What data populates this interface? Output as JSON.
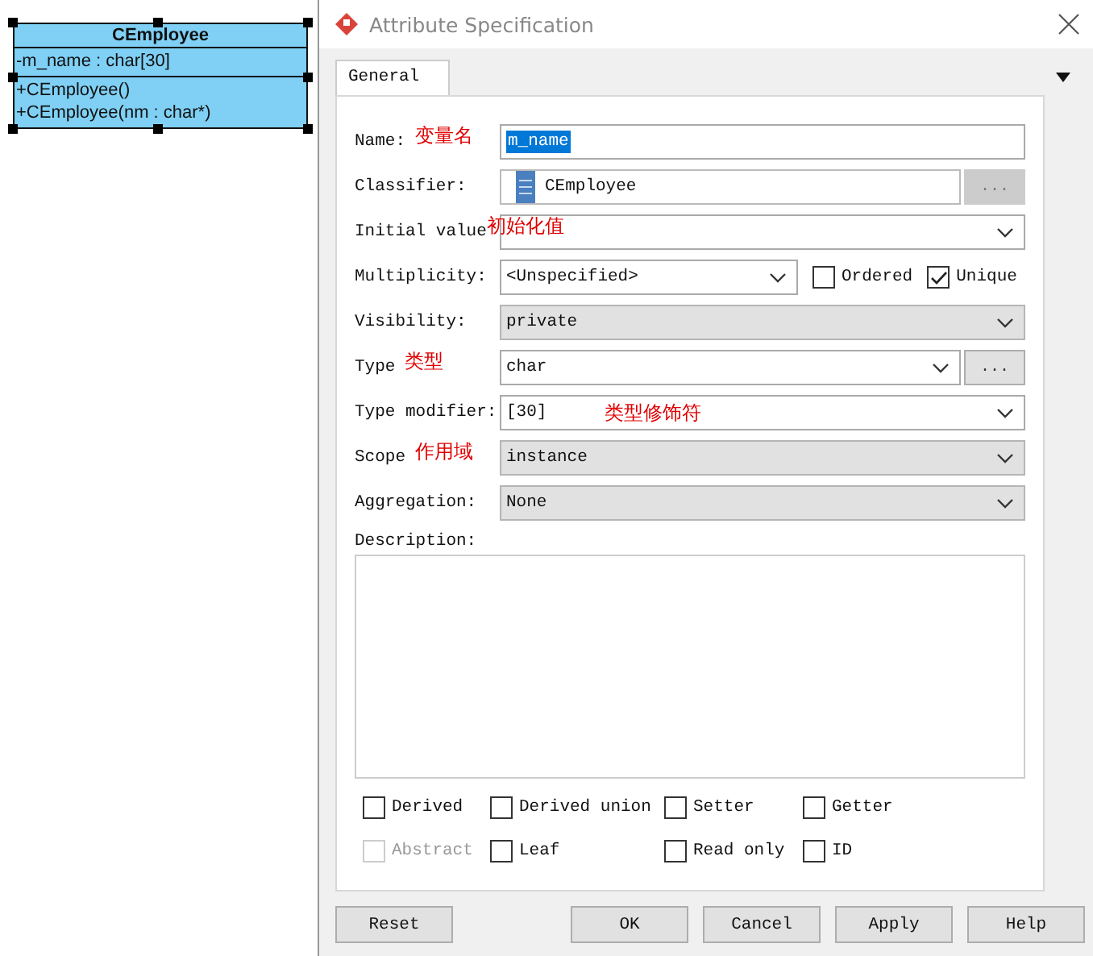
{
  "diagram": {
    "class_name": "CEmployee",
    "selected": true,
    "attributes": [
      "-m_name : char[30]"
    ],
    "operations": [
      "+CEmployee()",
      "+CEmployee(nm : char*)"
    ]
  },
  "dialog": {
    "title": "Attribute Specification",
    "tabs": [
      {
        "label": "General",
        "selected": true
      }
    ],
    "fields": [
      {
        "label": "Name:",
        "annotation": "变量名",
        "kind": "text",
        "value": "m_name",
        "text_selected": true
      },
      {
        "label": "Classifier:",
        "kind": "classifier",
        "value": "CEmployee",
        "browse_button": {
          "label": "...",
          "disabled": true
        }
      },
      {
        "label": "Initial value",
        "annotation": "初始化值",
        "kind": "combo"
      },
      {
        "label": "Multiplicity:",
        "kind": "combo",
        "value": "<Unspecified>",
        "options": [
          {
            "label": "Ordered",
            "checked": false
          },
          {
            "label": "Unique",
            "checked": true
          }
        ]
      },
      {
        "label": "Visibility:",
        "kind": "select",
        "value": "private"
      },
      {
        "label": "Type",
        "annotation": "类型",
        "kind": "combo",
        "value": "char",
        "browse_button": {
          "label": "...",
          "disabled": false
        }
      },
      {
        "label": "Type modifier:",
        "kind": "combo",
        "value": "[30]",
        "value_annotation": "类型修饰符"
      },
      {
        "label": "Scope",
        "annotation": "作用域",
        "kind": "select",
        "value": "instance"
      },
      {
        "label": "Aggregation:",
        "kind": "select",
        "value": "None"
      }
    ],
    "description_label": "Description:",
    "flags": [
      {
        "label": "Derived",
        "checked": false,
        "disabled": false
      },
      {
        "label": "Derived union",
        "checked": false,
        "disabled": false
      },
      {
        "label": "Setter",
        "checked": false,
        "disabled": false
      },
      {
        "label": "Getter",
        "checked": false,
        "disabled": false
      },
      {
        "label": "Abstract",
        "checked": false,
        "disabled": true
      },
      {
        "label": "Leaf",
        "checked": false,
        "disabled": false
      },
      {
        "label": "Read only",
        "checked": false,
        "disabled": false
      },
      {
        "label": "ID",
        "checked": false,
        "disabled": false
      }
    ],
    "buttons": [
      {
        "label": "Reset",
        "kind": "left"
      },
      {
        "label": "OK",
        "kind": "right"
      },
      {
        "label": "Cancel",
        "kind": "right"
      },
      {
        "label": "Apply",
        "kind": "right"
      },
      {
        "label": "Help",
        "kind": "right"
      }
    ]
  }
}
